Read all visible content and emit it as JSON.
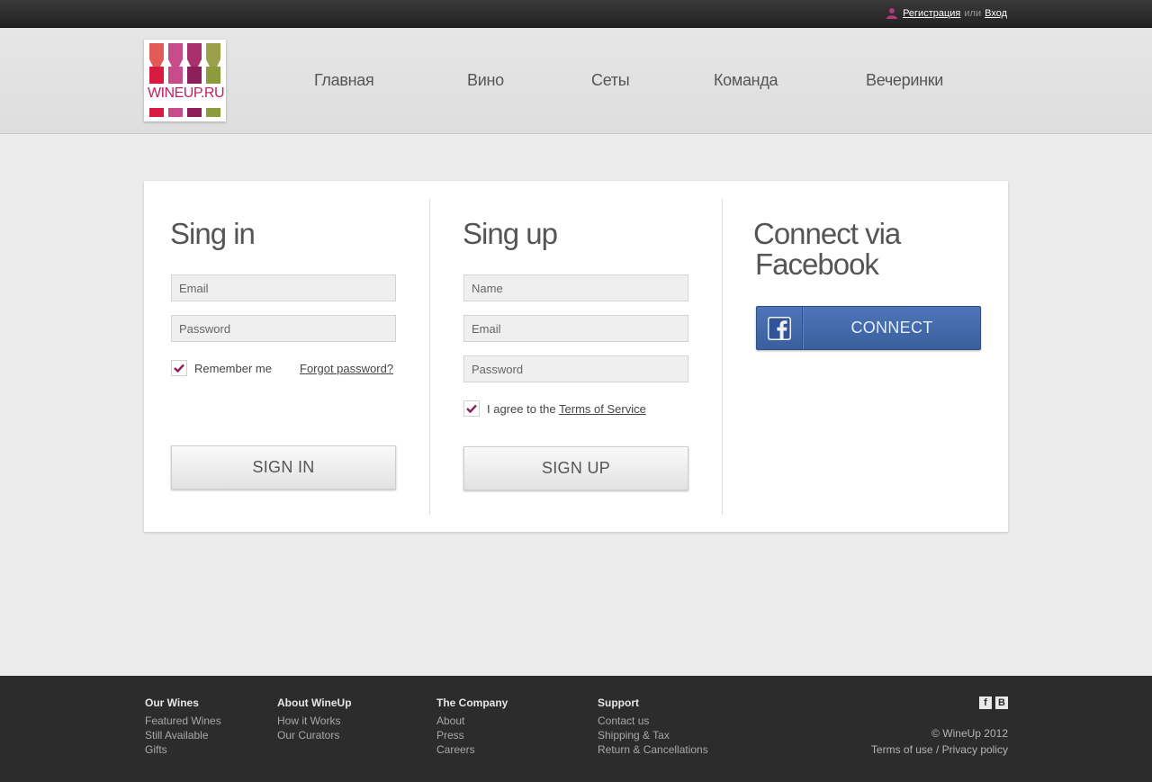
{
  "topbar": {
    "register": "Регистрация",
    "or": "или",
    "login": "Вход"
  },
  "logo": {
    "text": "WINEUP.RU"
  },
  "nav": [
    "Главная",
    "Вино",
    "Сеты",
    "Команда",
    "Вечеринки"
  ],
  "signin": {
    "title": "Sing in",
    "email_placeholder": "Email",
    "password_placeholder": "Password",
    "remember": "Remember me",
    "forgot": "Forgot password?",
    "button": "SIGN IN"
  },
  "signup": {
    "title": "Sing up",
    "name_placeholder": "Name",
    "email_placeholder": "Email",
    "password_placeholder": "Password",
    "agree_prefix": "I agree to the",
    "tos": "Terms of Service",
    "button": "SIGN UP"
  },
  "facebook": {
    "title_line1": "Connect via",
    "title_line2": "Facebook",
    "button": "CONNECT"
  },
  "footer": {
    "cols": [
      {
        "head": "Our Wines",
        "links": [
          "Featured Wines",
          "Still Available",
          "Gifts"
        ]
      },
      {
        "head": "About WineUp",
        "links": [
          "How it Works",
          "Our Curators"
        ]
      },
      {
        "head": "The Company",
        "links": [
          "About",
          "Press",
          "Careers"
        ]
      },
      {
        "head": "Support",
        "links": [
          "Contact us",
          "Shipping & Tax",
          "Return & Cancellations"
        ]
      }
    ],
    "social": [
      "f",
      "B"
    ],
    "copyright": "© WineUp 2012",
    "terms": "Terms of use",
    "sep": "/",
    "privacy": "Privacy policy"
  },
  "colors": {
    "accent": "#8e1f5a",
    "facebook": "#3f65a6",
    "footer_bg": "#2c2c2c"
  }
}
